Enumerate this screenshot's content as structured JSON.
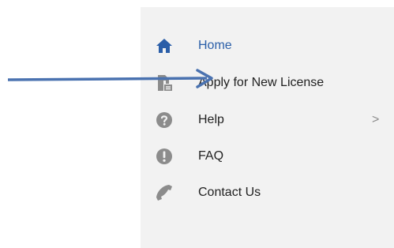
{
  "menu": {
    "items": [
      {
        "label": "Home",
        "icon": "home-icon",
        "active": true
      },
      {
        "label": "Apply for New License",
        "icon": "apply-document-icon",
        "active": false
      },
      {
        "label": "Help",
        "icon": "question-circle-icon",
        "active": false,
        "has_submenu": true
      },
      {
        "label": "FAQ",
        "icon": "exclamation-circle-icon",
        "active": false
      },
      {
        "label": "Contact Us",
        "icon": "phone-icon",
        "active": false
      }
    ],
    "submenu_indicator": ">"
  },
  "colors": {
    "panel_background": "#f2f2f2",
    "active_text": "#2a5ea8",
    "active_icon": "#2a5ea8",
    "inactive_icon": "#8c8c8c",
    "text": "#222222",
    "annotation_arrow": "#4a72b0"
  },
  "annotation": {
    "type": "arrow",
    "points_to": "Apply for New License"
  }
}
